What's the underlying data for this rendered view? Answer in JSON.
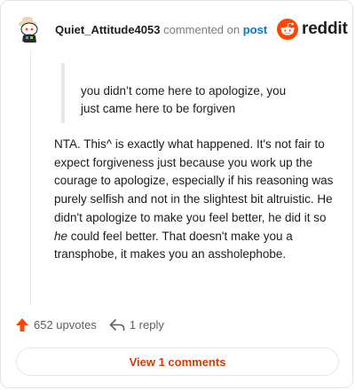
{
  "comment": {
    "username": "Quiet_Attitude4053",
    "action_text": "commented on",
    "post_link": "post",
    "quote_lines": [
      "you didn’t come here to apologize, you",
      "just came here to be forgiven"
    ],
    "body_before_em": "NTA. This^ is exactly what happened. It's not fair to expect forgiveness just because you work up the courage to apologize, especially if his reasoning was purely selfish and not in the slightest bit altruistic. He didn't apologize to make you feel better, he did it so ",
    "body_em": "he",
    "body_after_em": " could feel better. That doesn't make you a transphobe, it makes you an assholephobe."
  },
  "brand": {
    "name": "reddit"
  },
  "actions": {
    "upvotes": "652 upvotes",
    "replies": "1 reply"
  },
  "footer": {
    "view_comments": "View 1 comments"
  },
  "colors": {
    "upvote": "#ff4500",
    "accent": "#d93a00",
    "link": "#0079d3"
  },
  "icons": [
    "snoo-avatar-icon",
    "reddit-logo-icon",
    "upvote-arrow-icon",
    "reply-arrow-icon"
  ]
}
